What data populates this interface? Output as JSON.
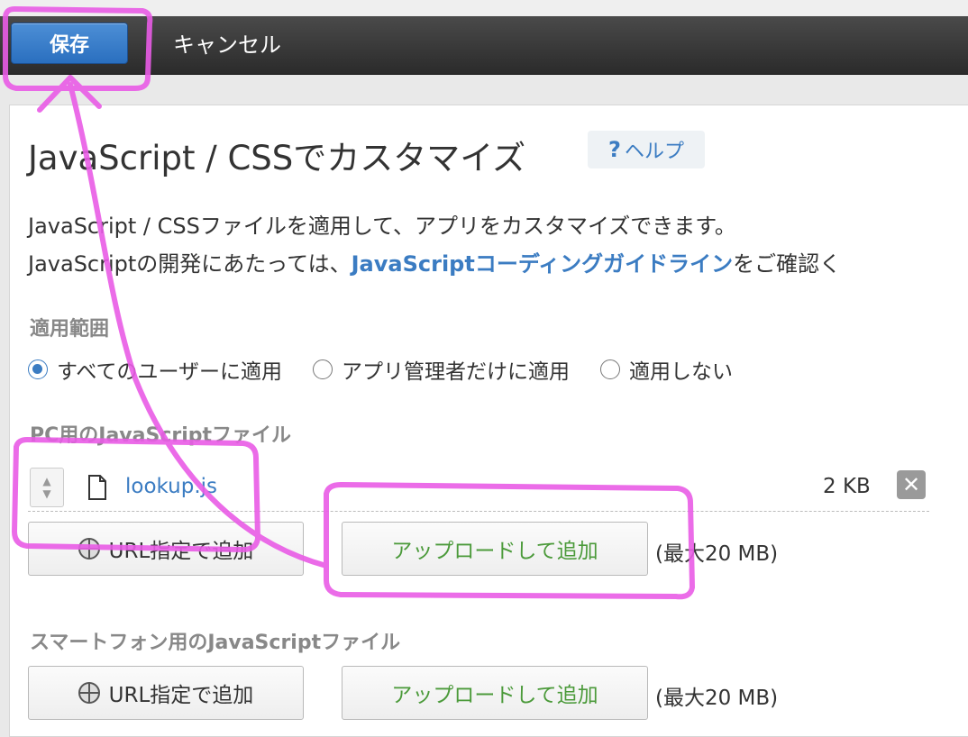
{
  "toolbar": {
    "save_label": "保存",
    "cancel_label": "キャンセル"
  },
  "page": {
    "title": "JavaScript / CSSでカスタマイズ",
    "help_q": "?",
    "help_label": "ヘルプ",
    "desc_line1": "JavaScript / CSSファイルを適用して、アプリをカスタマイズできます。",
    "desc_line2_prefix": "JavaScriptの開発にあたっては、",
    "desc_line2_link": "JavaScriptコーディングガイドライン",
    "desc_line2_suffix": "をご確認く"
  },
  "scope": {
    "label": "適用範囲",
    "options": [
      {
        "label": "すべてのユーザーに適用",
        "checked": true
      },
      {
        "label": "アプリ管理者だけに適用",
        "checked": false
      },
      {
        "label": "適用しない",
        "checked": false
      }
    ]
  },
  "pc_js": {
    "label": "PC用のJavaScriptファイル",
    "file": {
      "name": "lookup.js",
      "size": "2 KB",
      "remove": "✕"
    },
    "url_button": "URL指定で追加",
    "upload_button": "アップロードして追加",
    "max_size": "(最大20 MB)"
  },
  "mobile_js": {
    "label": "スマートフォン用のJavaScriptファイル",
    "url_button": "URL指定で追加",
    "upload_button": "アップロードして追加",
    "max_size": "(最大20 MB)"
  },
  "colors": {
    "accent": "#3b7cc2",
    "save": "#2a6fbf",
    "upload_text": "#4b9a3a",
    "annotation": "#e95ce6"
  },
  "icons": {
    "file": "file-icon",
    "globe": "globe-icon",
    "sort": "sort-arrows-icon",
    "remove": "close-icon"
  }
}
